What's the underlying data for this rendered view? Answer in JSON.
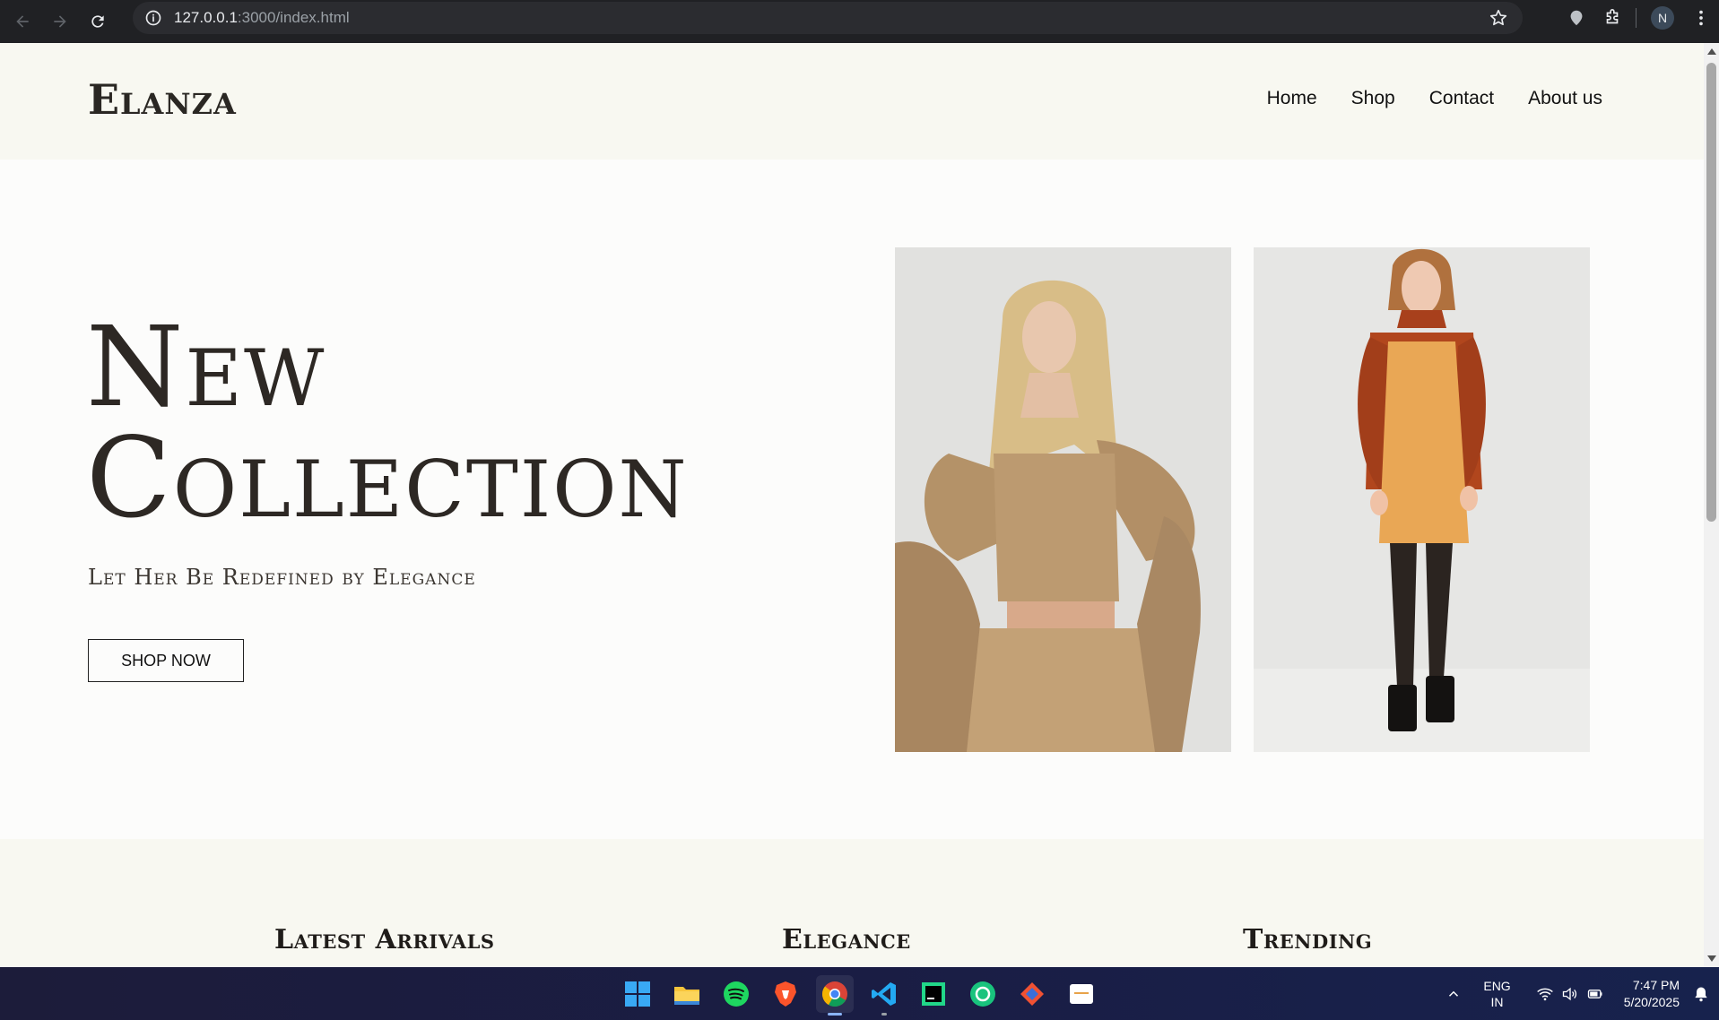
{
  "browser": {
    "url_host": "127.0.0.1",
    "url_path": ":3000/index.html",
    "profile_initial": "N"
  },
  "site": {
    "logo": "Elanza",
    "nav": [
      "Home",
      "Shop",
      "Contact",
      "About us"
    ]
  },
  "hero": {
    "title_line1": "New",
    "title_line2": "Collection",
    "subtitle": "Let Her Be Redefined by Elegance",
    "cta": "SHOP NOW"
  },
  "features": [
    "Latest Arrivals",
    "Elegance",
    "Trending"
  ],
  "taskbar": {
    "apps": [
      "start-icon",
      "file-explorer-icon",
      "spotify-icon",
      "brave-icon",
      "chrome-icon",
      "vscode-icon",
      "pycharm-icon",
      "chatgpt-icon",
      "git-icon",
      "notes-app-icon"
    ],
    "language_line1": "ENG",
    "language_line2": "IN",
    "time": "7:47 PM",
    "date": "5/20/2025"
  },
  "colors": {
    "header_bg": "#f8f8f1",
    "page_bg": "#fcfcfb",
    "text_dark": "#2d2824"
  }
}
